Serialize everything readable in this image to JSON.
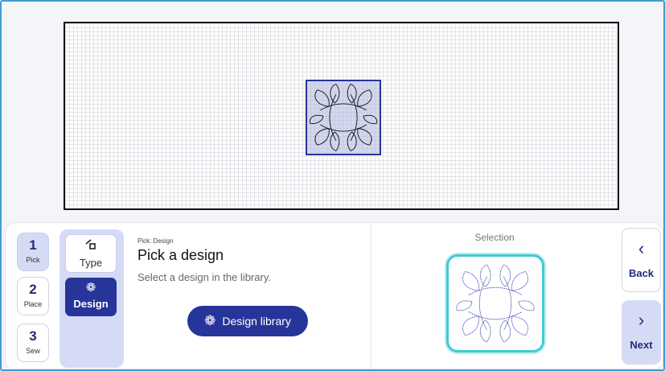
{
  "canvas": {
    "design": "leaf-wreath-block"
  },
  "steps": [
    {
      "num": "1",
      "label": "Pick"
    },
    {
      "num": "2",
      "label": "Place"
    },
    {
      "num": "3",
      "label": "Sew"
    }
  ],
  "substeps": {
    "type": {
      "label": "Type",
      "icon": "type-shapes-icon"
    },
    "design": {
      "label": "Design",
      "icon": "flower-icon"
    }
  },
  "pick": {
    "breadcrumb": "Pick: Design",
    "heading": "Pick a design",
    "hint": "Select a design in the library.",
    "library_button": "Design library"
  },
  "selection": {
    "title": "Selection"
  },
  "nav": {
    "back": "Back",
    "next": "Next"
  },
  "colors": {
    "accent": "#27349a",
    "highlight": "#3fcbd3",
    "frame": "#3b9fd8"
  }
}
